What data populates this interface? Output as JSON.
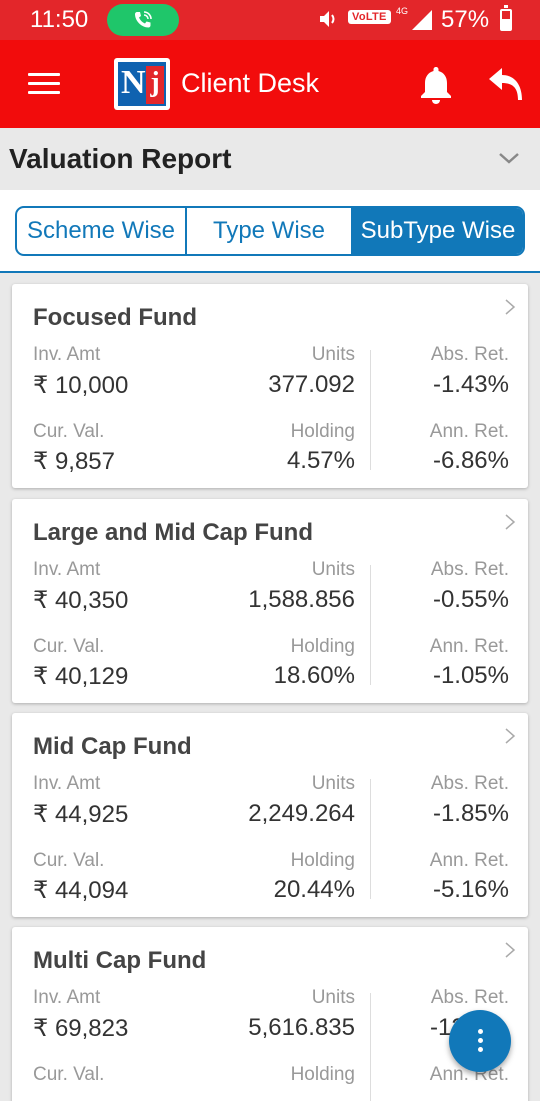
{
  "status_bar": {
    "time": "11:50",
    "volte": "VoLTE",
    "network": "4G",
    "battery": "57%",
    "battery_level": 0.57
  },
  "app_bar": {
    "logo_text": "Nj",
    "title": "Client Desk",
    "icons": [
      "menu-icon",
      "bell-icon",
      "back-icon"
    ]
  },
  "report": {
    "title": "Valuation Report"
  },
  "tabs": [
    {
      "label": "Scheme Wise",
      "active": false
    },
    {
      "label": "Type Wise",
      "active": false
    },
    {
      "label": "SubType Wise",
      "active": true
    }
  ],
  "labels": {
    "inv_amt": "Inv. Amt",
    "units": "Units",
    "abs_ret": "Abs. Ret.",
    "cur_val": "Cur. Val.",
    "holding": "Holding",
    "ann_ret": "Ann. Ret."
  },
  "funds": [
    {
      "name": "Focused Fund",
      "inv_amt": "₹ 10,000",
      "units": "377.092",
      "abs_ret": "-1.43%",
      "cur_val": "₹ 9,857",
      "holding": "4.57%",
      "ann_ret": "-6.86%"
    },
    {
      "name": "Large and Mid Cap Fund",
      "inv_amt": "₹ 40,350",
      "units": "1,588.856",
      "abs_ret": "-0.55%",
      "cur_val": "₹ 40,129",
      "holding": "18.60%",
      "ann_ret": "-1.05%"
    },
    {
      "name": "Mid Cap Fund",
      "inv_amt": "₹ 44,925",
      "units": "2,249.264",
      "abs_ret": "-1.85%",
      "cur_val": "₹ 44,094",
      "holding": "20.44%",
      "ann_ret": "-5.16%"
    },
    {
      "name": "Multi Cap Fund",
      "inv_amt": "₹ 69,823",
      "units": "5,616.835",
      "abs_ret": "-12",
      "cur_val": "",
      "holding": "",
      "ann_ret": ""
    }
  ],
  "colors": {
    "app_bar": "#f20c0c",
    "accent": "#1178b9",
    "call_pill": "#1fc66a"
  }
}
